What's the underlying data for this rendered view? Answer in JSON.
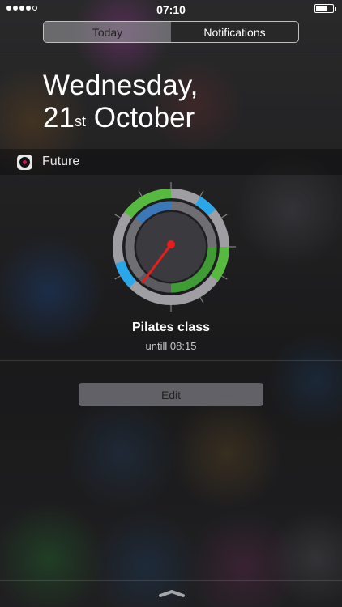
{
  "status_bar": {
    "time": "07:10",
    "signal_bars_filled": 4,
    "signal_bars_total": 5,
    "battery_level": 0.55
  },
  "tabs": [
    {
      "label": "Today",
      "active": true
    },
    {
      "label": "Notifications",
      "active": false
    }
  ],
  "date": {
    "weekday": "Wednesday,",
    "day": "21",
    "ordinal_suffix": "st",
    "month": "October"
  },
  "widget": {
    "app_name": "Future",
    "app_icon": "camera-lens-icon",
    "event_title": "Pilates class",
    "event_subtitle": "untill 08:15"
  },
  "buttons": {
    "edit_label": "Edit"
  },
  "colors": {
    "green": "#57b93f",
    "dark_green": "#3f9b34",
    "blue": "#2aa7e8",
    "gray": "#9e9ea3",
    "needle": "#e81d1d"
  }
}
